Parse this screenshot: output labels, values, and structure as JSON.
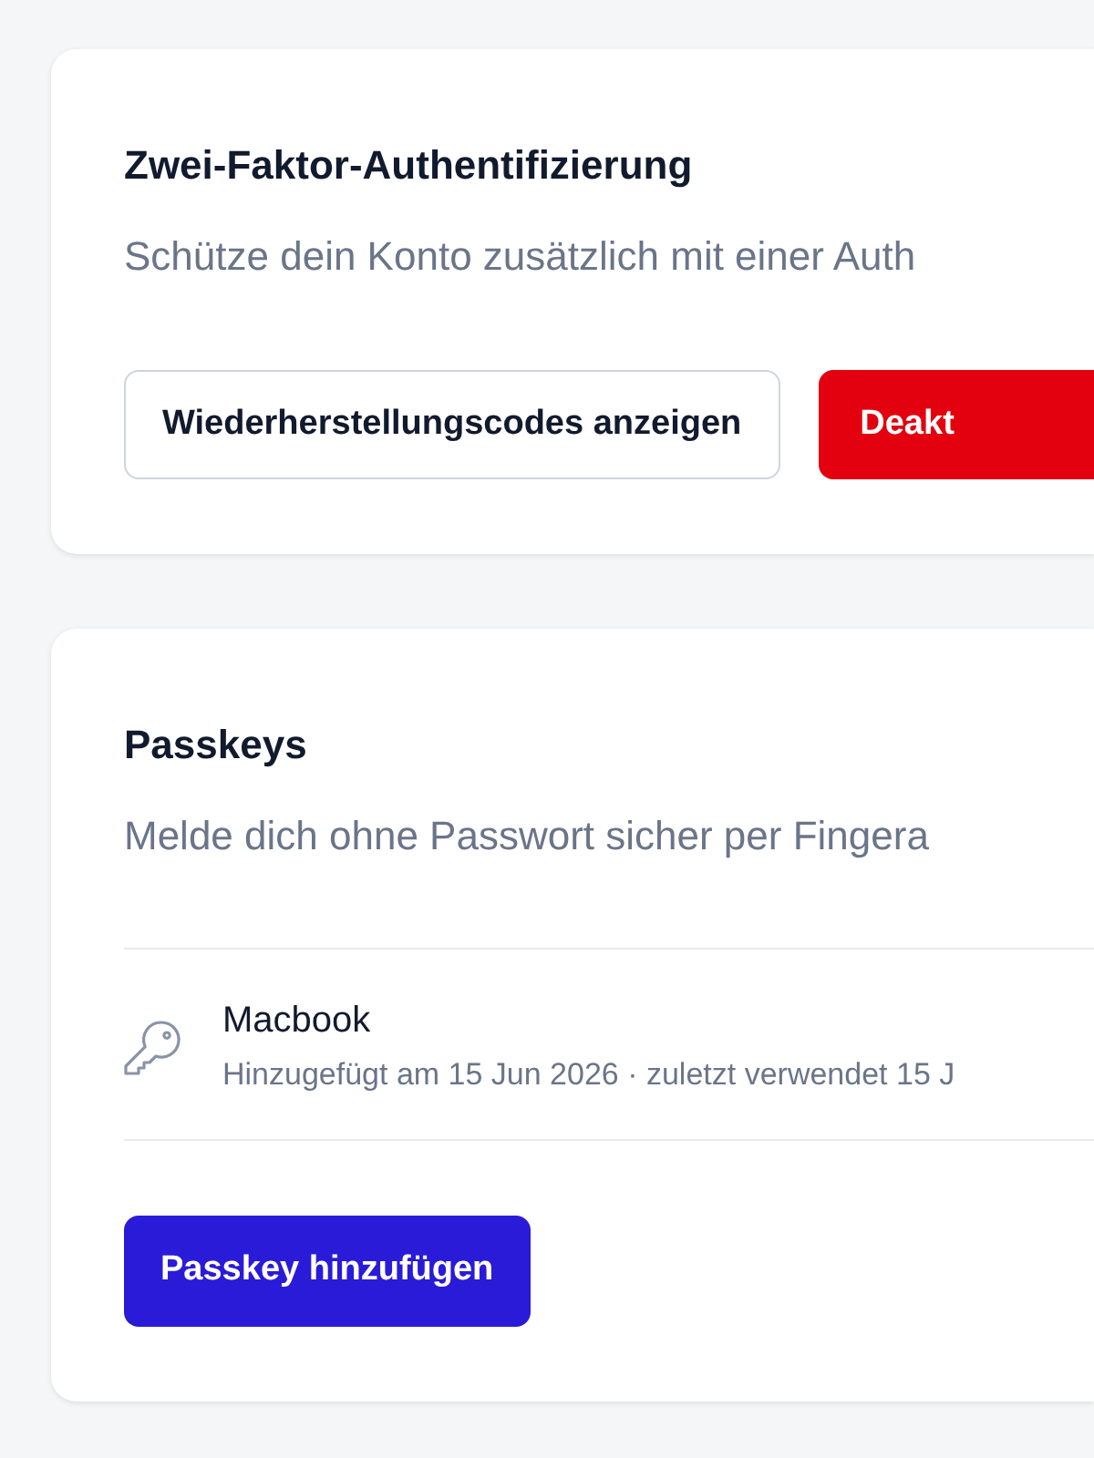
{
  "two_factor": {
    "title": "Zwei-Faktor-Authentifizierung",
    "description": "Schütze dein Konto zusätzlich mit einer Auth",
    "buttons": [
      {
        "label": "Wiederherstellungscodes anzeigen",
        "kind": "secondary"
      },
      {
        "label": "Deakt",
        "kind": "danger"
      }
    ]
  },
  "passkeys": {
    "title": "Passkeys",
    "description": "Melde dich ohne Passwort sicher per Fingera",
    "items": [
      {
        "name": "Macbook",
        "meta": "Hinzugefügt am 15 Jun 2026 · zuletzt verwendet 15 J"
      }
    ],
    "buttons": [
      {
        "label": "Passkey hinzufügen",
        "kind": "primary"
      }
    ]
  }
}
